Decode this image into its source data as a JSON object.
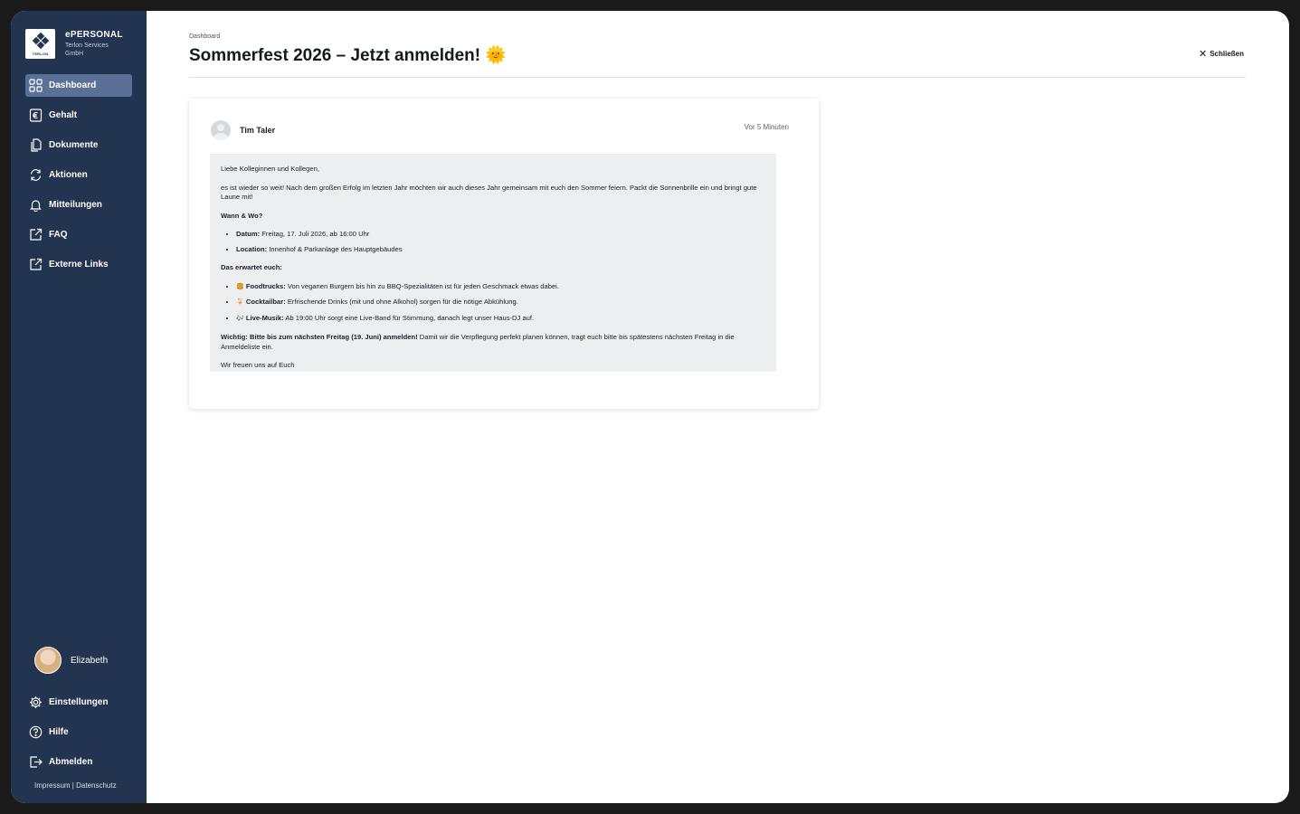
{
  "brand": {
    "logo_text": "TERLON",
    "name": "ePERSONAL",
    "company": "Terlon Services GmbH"
  },
  "nav": [
    {
      "label": "Dashboard",
      "icon": "grid-icon",
      "active": true
    },
    {
      "label": "Gehalt",
      "icon": "euro-icon"
    },
    {
      "label": "Dokumente",
      "icon": "documents-icon"
    },
    {
      "label": "Aktionen",
      "icon": "refresh-icon"
    },
    {
      "label": "Mitteilungen",
      "icon": "bell-icon"
    },
    {
      "label": "FAQ",
      "icon": "external-link-icon"
    },
    {
      "label": "Externe Links",
      "icon": "external-link-icon"
    }
  ],
  "user": {
    "name": "Elizabeth"
  },
  "bottom_nav": [
    {
      "label": "Einstellungen",
      "icon": "gear-icon"
    },
    {
      "label": "Hilfe",
      "icon": "help-icon"
    },
    {
      "label": "Abmelden",
      "icon": "logout-icon"
    }
  ],
  "footer": {
    "impressum": "Impressum",
    "separator": "|",
    "datenschutz": "Datenschutz"
  },
  "header": {
    "breadcrumb": "Dashboard",
    "title": "Sommerfest 2026 – Jetzt anmelden! 🌞",
    "close_label": "Schließen"
  },
  "post": {
    "author": "Tim Taler",
    "timestamp": "Vor 5 Minuten",
    "greeting": "Liebe Kolleginnen und Kollegen,",
    "intro": "es ist wieder so weit! Nach dem großen Erfolg im letzten Jahr möchten wir auch dieses Jahr gemeinsam mit euch den Sommer feiern. Packt die Sonnenbrille ein und bringt gute Laune mit!",
    "when_heading": "Wann & Wo?",
    "when_items": [
      {
        "label": "Datum:",
        "text": "Freitag, 17. Juli 2026, ab 16:00 Uhr"
      },
      {
        "label": "Location:",
        "text": "Innenhof & Parkanlage des Hauptgebäudes"
      }
    ],
    "expect_heading": "Das erwartet euch:",
    "expect_items": [
      {
        "emoji": "🍔",
        "label": "Foodtrucks:",
        "text": "Von veganen Burgern bis hin zu BBQ-Spezialitäten ist für jeden Geschmack etwas dabei."
      },
      {
        "emoji": "🍹",
        "label": "Cocktailbar:",
        "text": "Erfrischende Drinks (mit und ohne Alkohol) sorgen für die nötige Abkühlung."
      },
      {
        "emoji": "🎶",
        "label": "Live-Musik:",
        "text": "Ab 19:00 Uhr sorgt eine Live-Band für Stimmung, danach legt unser Haus-DJ auf."
      }
    ],
    "important_bold": "Wichtig: Bitte bis zum nächsten Freitag (19. Juni) anmelden!",
    "important_text": " Damit wir die Verpflegung perfekt planen können, tragt euch bitte bis spätestens nächsten Freitag in die Anmeldeliste ein.",
    "closing": "Wir freuen uns auf Euch"
  }
}
